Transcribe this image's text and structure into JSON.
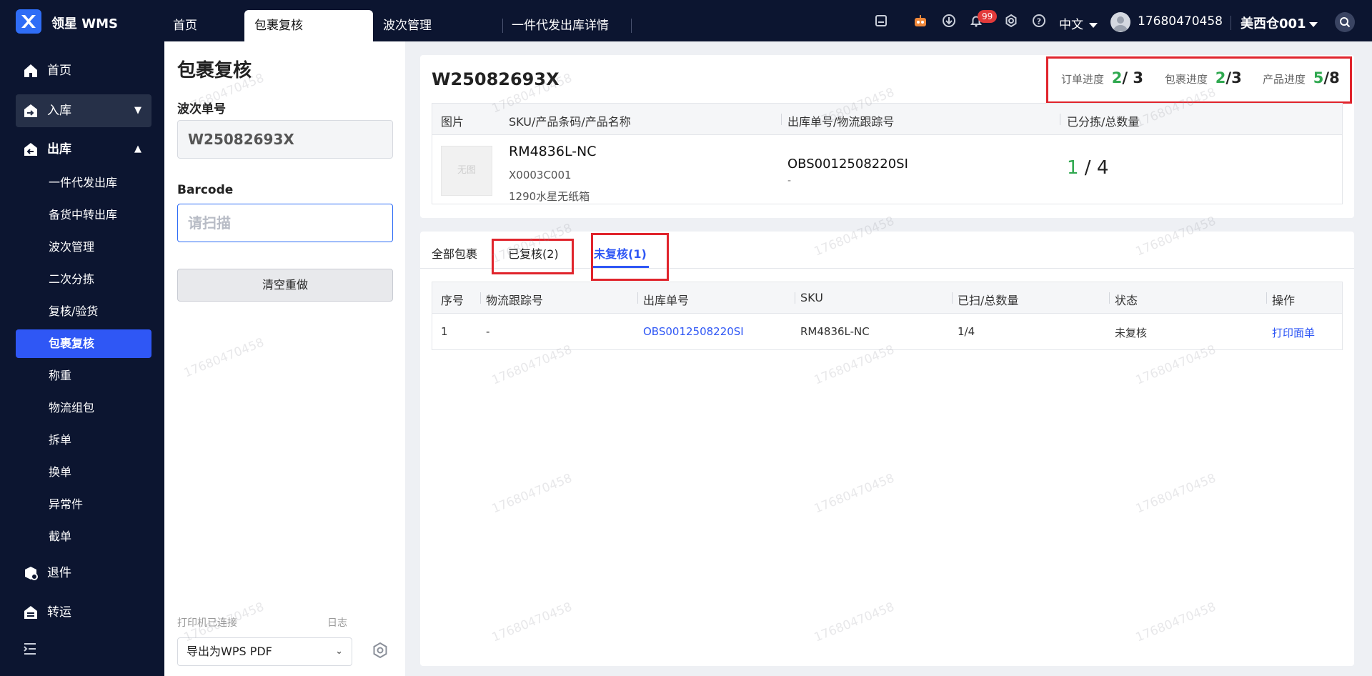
{
  "app": {
    "brand": "领星 WMS"
  },
  "topbar": {
    "tabs": [
      {
        "label": "首页"
      },
      {
        "label": "包裹复核"
      },
      {
        "label": "波次管理"
      },
      {
        "label": "一件代发出库详情"
      }
    ],
    "notification_count": "99",
    "language": "中文",
    "username": "17680470458",
    "warehouse": "美西仓001"
  },
  "sidebar": {
    "home": "首页",
    "inbound": "入库",
    "outbound": "出库",
    "outbound_items": [
      "一件代发出库",
      "备货中转出库",
      "波次管理",
      "二次分拣",
      "复核/验货",
      "包裹复核",
      "称重",
      "物流组包",
      "拆单",
      "换单",
      "异常件",
      "截单"
    ],
    "returns": "退件",
    "transfer": "转运"
  },
  "form": {
    "title": "包裹复核",
    "wave_label": "波次单号",
    "wave_value": "W25082693X",
    "barcode_label": "Barcode",
    "barcode_placeholder": "请扫描",
    "reset_button": "清空重做",
    "printer_status": "打印机已连接",
    "log_link": "日志",
    "printer_select": "导出为WPS PDF"
  },
  "summary": {
    "wave_no": "W25082693X",
    "order_progress_label": "订单进度",
    "order_done": "2",
    "order_total": "/ 3",
    "package_progress_label": "包裹进度",
    "package_done": "2",
    "package_total": "/3",
    "product_progress_label": "产品进度",
    "product_done": "5",
    "product_total": "/8",
    "headers": [
      "图片",
      "SKU/产品条码/产品名称",
      "出库单号/物流跟踪号",
      "已分拣/总数量"
    ],
    "no_image": "无图",
    "sku": "RM4836L-NC",
    "barcode": "X0003C001",
    "product_name": "1290水星无纸箱",
    "outbound_no": "OBS0012508220SI",
    "tracking_no": "-",
    "sorted_done": "1",
    "sorted_total": " / 4"
  },
  "packages": {
    "tabs": [
      "全部包裹",
      "已复核(2)",
      "未复核(1)"
    ],
    "active_tab": "未复核(1)",
    "headers": [
      "序号",
      "物流跟踪号",
      "出库单号",
      "SKU",
      "已扫/总数量",
      "状态",
      "操作"
    ],
    "rows": [
      {
        "index": "1",
        "tracking": "-",
        "outbound_no": "OBS0012508220SI",
        "sku": "RM4836L-NC",
        "scanned": "1/4",
        "status": "未复核",
        "action": "打印面单"
      }
    ]
  },
  "colors": {
    "accent": "#2f57f5",
    "nav_bg": "#0c1530",
    "done_green": "#2fa84f",
    "highlight_red": "#e0242c"
  }
}
